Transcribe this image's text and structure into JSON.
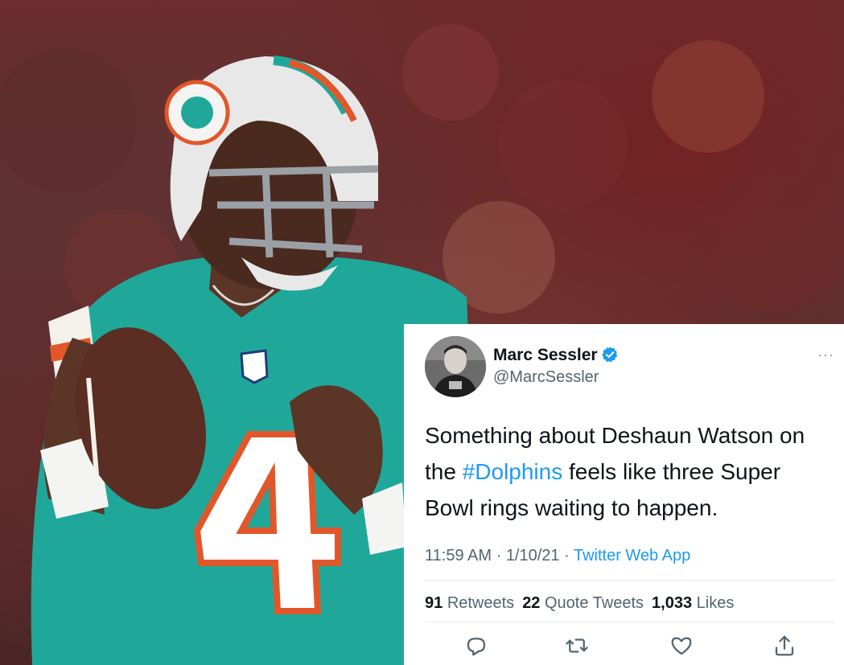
{
  "photo": {
    "jersey_number": "4",
    "jersey_color": "#1fa89a",
    "helmet_color": "#e8e8e8"
  },
  "tweet": {
    "display_name": "Marc Sessler",
    "handle": "@MarcSessler",
    "verified": true,
    "text_before": "Something about Deshaun Watson on the ",
    "hashtag": "#Dolphins",
    "text_after": " feels like three Super Bowl rings waiting to happen.",
    "time": "11:59 AM",
    "date": "1/10/21",
    "source": "Twitter Web App",
    "separator": " · ",
    "retweets_count": "91",
    "retweets_label": "Retweets",
    "quotes_count": "22",
    "quotes_label": "Quote Tweets",
    "likes_count": "1,033",
    "likes_label": "Likes",
    "more_label": "···",
    "actions": [
      "reply-icon",
      "retweet-icon",
      "like-icon",
      "share-icon"
    ],
    "colors": {
      "link": "#1d9bf0",
      "secondary": "#536471",
      "primary": "#0f1419"
    }
  }
}
